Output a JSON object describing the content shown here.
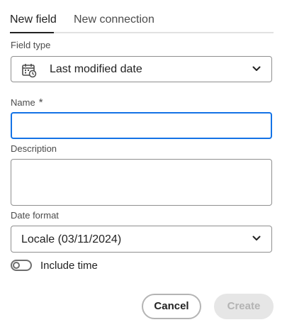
{
  "tabs": [
    {
      "label": "New field",
      "active": true
    },
    {
      "label": "New connection",
      "active": false
    }
  ],
  "field_type": {
    "label": "Field type",
    "selected_value": "Last modified date",
    "icon": "calendar-clock-icon"
  },
  "name": {
    "label": "Name",
    "required_marker": "*",
    "value": ""
  },
  "description": {
    "label": "Description",
    "value": ""
  },
  "date_format": {
    "label": "Date format",
    "selected_value": "Locale (03/11/2024)"
  },
  "include_time": {
    "label": "Include time",
    "checked": false
  },
  "actions": {
    "cancel_label": "Cancel",
    "create_label": "Create",
    "create_disabled": true
  },
  "colors": {
    "focus_border": "#1473e6",
    "text": "#222222",
    "disabled_bg": "#e6e6e6"
  }
}
